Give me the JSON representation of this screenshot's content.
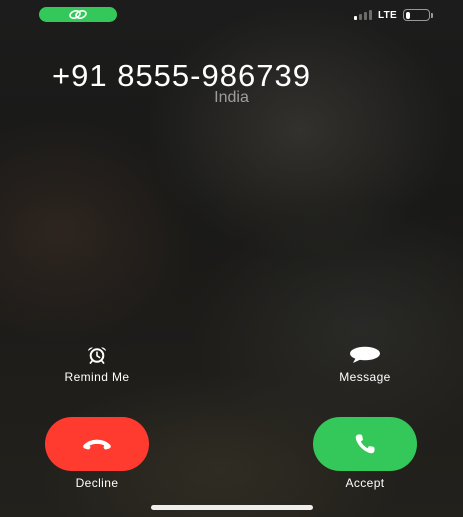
{
  "status_bar": {
    "network": "LTE",
    "battery_level": "23",
    "battery_fraction": 0.23,
    "signal_bars_active": 1,
    "signal_bars_total": 4,
    "call_pill_icon": "link-icon",
    "accent": "#34c759"
  },
  "caller": {
    "number": "+91 8555-986739",
    "location": "India"
  },
  "actions": {
    "remind": {
      "label": "Remind Me",
      "icon": "alarm-clock-icon"
    },
    "message": {
      "label": "Message",
      "icon": "speech-bubble-icon"
    }
  },
  "call_buttons": {
    "decline": {
      "label": "Decline",
      "icon": "hang-up-phone-icon",
      "color": "#ff3b30"
    },
    "accept": {
      "label": "Accept",
      "icon": "phone-icon",
      "color": "#34c759"
    }
  }
}
